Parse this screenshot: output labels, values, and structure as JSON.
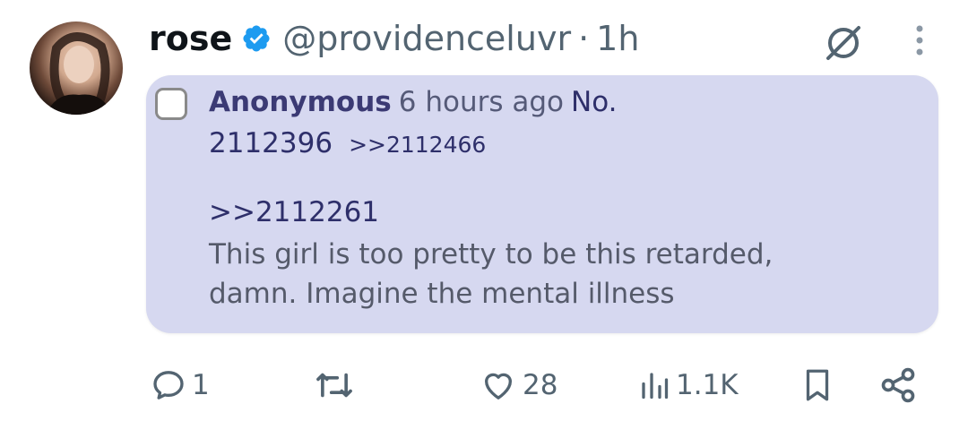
{
  "tweet": {
    "display_name": "rose",
    "handle": "@providenceluvr",
    "separator": "·",
    "time": "1h",
    "icons": {
      "avatar": "profile-photo",
      "verified": "verified-badge-icon",
      "grok": "grok-icon",
      "more": "more-vertical-icon"
    },
    "colors": {
      "verified": "#1d9bf0",
      "card_bg": "#d6d8f0"
    }
  },
  "post": {
    "author": "Anonymous",
    "ago": "6 hours ago",
    "no_label": "No.",
    "post_number": "2112396",
    "backlink": ">>2112466",
    "quote_link": ">>2112261",
    "comment_line1": "This girl is too pretty to be this retarded,",
    "comment_line2": "damn. Imagine the mental illness"
  },
  "actions": {
    "reply_count": "1",
    "retweet_count": "",
    "like_count": "28",
    "views_count": "1.1K",
    "icons": [
      "reply-icon",
      "retweet-icon",
      "like-icon",
      "views-icon",
      "bookmark-icon",
      "share-icon"
    ]
  }
}
